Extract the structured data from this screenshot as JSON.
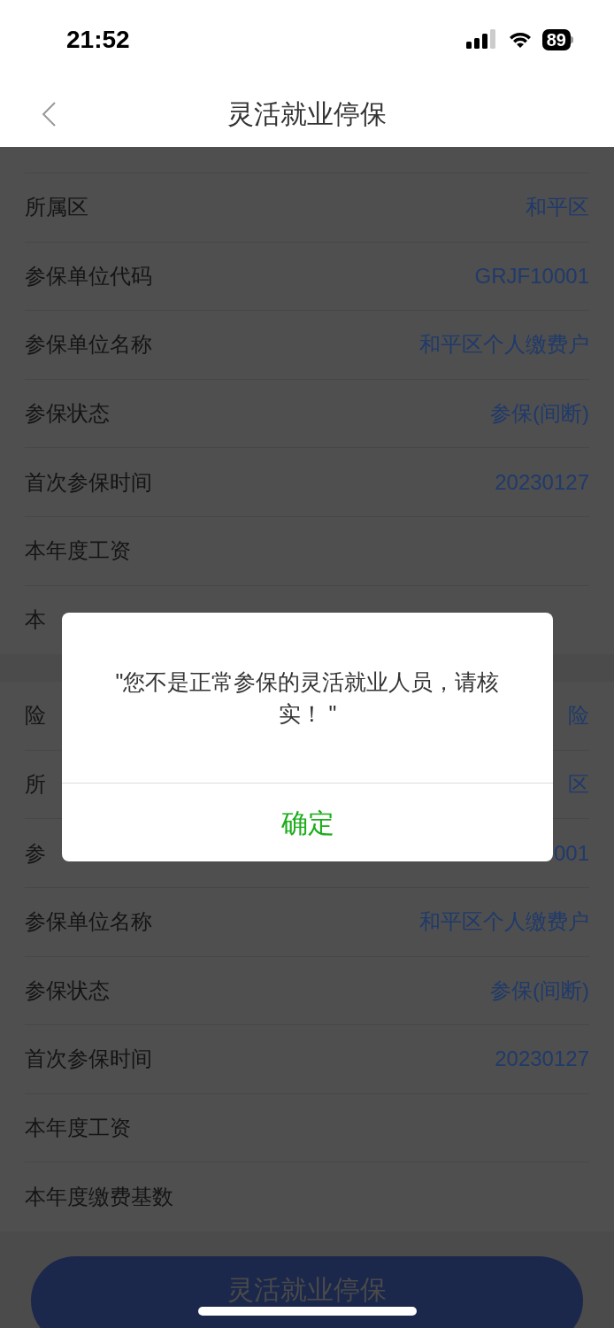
{
  "status_bar": {
    "time": "21:52",
    "battery": "89"
  },
  "nav": {
    "title": "灵活就业停保"
  },
  "sections": [
    {
      "rows": [
        {
          "label": "所属区",
          "value": "和平区"
        },
        {
          "label": "参保单位代码",
          "value": "GRJF10001"
        },
        {
          "label": "参保单位名称",
          "value": "和平区个人缴费户"
        },
        {
          "label": "参保状态",
          "value": "参保(间断)"
        },
        {
          "label": "首次参保时间",
          "value": "20230127"
        },
        {
          "label": "本年度工资"
        },
        {
          "label": "本"
        }
      ]
    },
    {
      "rows": [
        {
          "label": "险",
          "value": "险"
        },
        {
          "label": "所",
          "value": "区"
        },
        {
          "label": "参",
          "value": "001"
        },
        {
          "label": "参保单位名称",
          "value": "和平区个人缴费户"
        },
        {
          "label": "参保状态",
          "value": "参保(间断)"
        },
        {
          "label": "首次参保时间",
          "value": "20230127"
        },
        {
          "label": "本年度工资"
        },
        {
          "label": "本年度缴费基数"
        }
      ]
    }
  ],
  "dialog": {
    "message": "\"您不是正常参保的灵活就业人员，请核实！ \"",
    "button": "确定"
  },
  "submit_button": "灵活就业停保"
}
